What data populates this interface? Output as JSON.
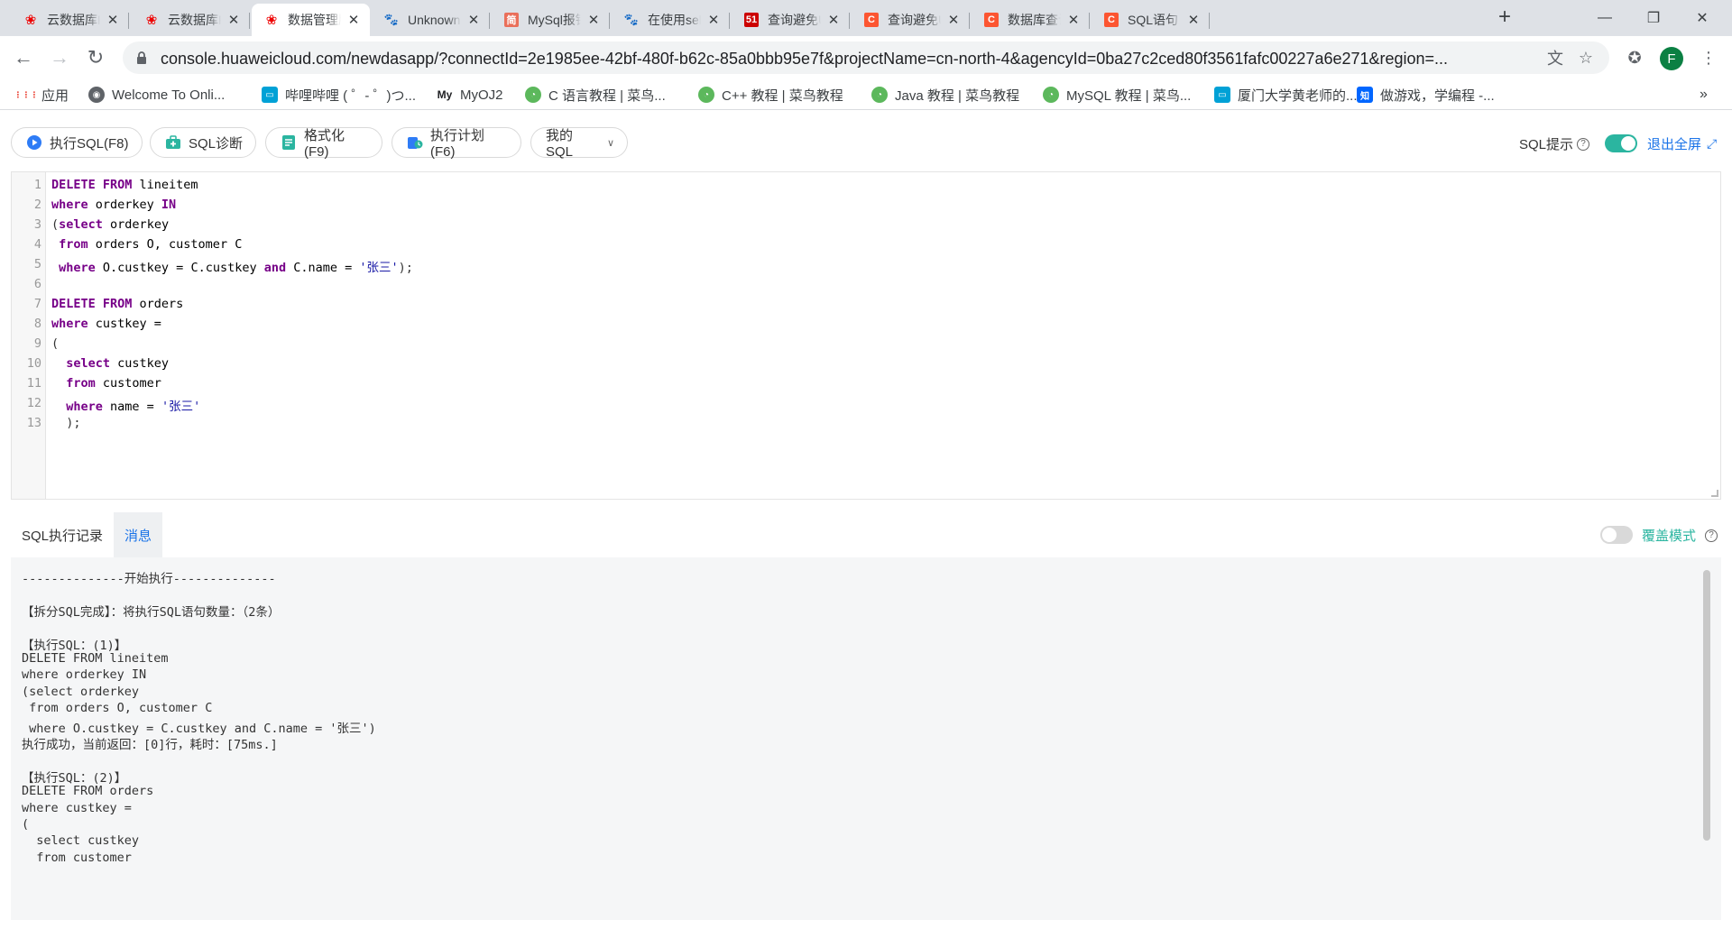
{
  "browser": {
    "tabs": [
      {
        "title": "云数据库RDS",
        "favicon": "huawei-icon"
      },
      {
        "title": "云数据库RDS",
        "favicon": "huawei-icon"
      },
      {
        "title": "数据管理服务",
        "favicon": "huawei-icon",
        "active": true
      },
      {
        "title": "Unknown column",
        "favicon": "baidu-paw-icon"
      },
      {
        "title": "MySql报错",
        "favicon": "jianshu-icon"
      },
      {
        "title": "在使用select",
        "favicon": "baidu-paw-icon"
      },
      {
        "title": "查询避免Un",
        "favicon": "51cto-icon"
      },
      {
        "title": "查询避免Un",
        "favicon": "csdn-icon"
      },
      {
        "title": "数据库查询",
        "favicon": "csdn-icon"
      },
      {
        "title": "SQL语句（三",
        "favicon": "csdn-icon"
      }
    ],
    "url": "console.huaweicloud.com/newdasapp/?connectId=2e1985ee-42bf-480f-b62c-85a0bbb95e7f&projectName=cn-north-4&agencyId=0ba27c2ced80f3561fafc00227a6e271&region=...",
    "profile_initial": "F",
    "bookmarks": [
      {
        "label": "应用",
        "icon": "apps-grid-icon"
      },
      {
        "label": "Welcome To Onli...",
        "icon": "globe-icon"
      },
      {
        "label": "哔哩哔哩 ( ゜- ゜)つ...",
        "icon": "bilibili-icon"
      },
      {
        "label": "MyOJ2",
        "icon": "myoj-icon"
      },
      {
        "label": "C 语言教程 | 菜鸟...",
        "icon": "runoob-icon"
      },
      {
        "label": "C++ 教程 | 菜鸟教程",
        "icon": "runoob-icon"
      },
      {
        "label": "Java 教程 | 菜鸟教程",
        "icon": "runoob-icon"
      },
      {
        "label": "MySQL 教程 | 菜鸟...",
        "icon": "runoob-icon"
      },
      {
        "label": "厦门大学黄老师的...",
        "icon": "bilibili-icon"
      },
      {
        "label": "做游戏，学编程 -...",
        "icon": "zhihu-icon"
      }
    ],
    "bookmarks_overflow": "»"
  },
  "toolbar": {
    "execute_label": "执行SQL(F8)",
    "diagnose_label": "SQL诊断",
    "format_label": "格式化(F9)",
    "plan_label": "执行计划(F6)",
    "mysql_label": "我的SQL",
    "sql_hint_label": "SQL提示",
    "sql_hint_enabled": true,
    "exit_fullscreen_label": "退出全屏"
  },
  "editor": {
    "line_numbers": [
      "1",
      "2",
      "3",
      "4",
      "5",
      "6",
      "7",
      "8",
      "9",
      "10",
      "11",
      "12",
      "13"
    ],
    "lines": [
      [
        {
          "t": "DELETE FROM",
          "c": "kw"
        },
        {
          "t": " lineitem",
          "c": "ident"
        }
      ],
      [
        {
          "t": "where",
          "c": "kw"
        },
        {
          "t": " orderkey ",
          "c": "ident"
        },
        {
          "t": "IN",
          "c": "kw"
        }
      ],
      [
        {
          "t": "(",
          "c": "op"
        },
        {
          "t": "select",
          "c": "kw"
        },
        {
          "t": " orderkey",
          "c": "ident"
        }
      ],
      [
        {
          "t": " from",
          "c": "kw"
        },
        {
          "t": " orders O, customer C",
          "c": "ident"
        }
      ],
      [
        {
          "t": " where",
          "c": "kw"
        },
        {
          "t": " O.custkey = C.custkey ",
          "c": "ident"
        },
        {
          "t": "and",
          "c": "kw"
        },
        {
          "t": " C.name = ",
          "c": "ident"
        },
        {
          "t": "'张三'",
          "c": "str"
        },
        {
          "t": ");",
          "c": "op"
        }
      ],
      [],
      [
        {
          "t": "DELETE FROM",
          "c": "kw"
        },
        {
          "t": " orders",
          "c": "ident"
        }
      ],
      [
        {
          "t": "where",
          "c": "kw"
        },
        {
          "t": " custkey =",
          "c": "ident"
        }
      ],
      [
        {
          "t": "(",
          "c": "op"
        }
      ],
      [
        {
          "t": "  select",
          "c": "kw"
        },
        {
          "t": " custkey",
          "c": "ident"
        }
      ],
      [
        {
          "t": "  from",
          "c": "kw"
        },
        {
          "t": " customer",
          "c": "ident"
        }
      ],
      [
        {
          "t": "  where",
          "c": "kw"
        },
        {
          "t": " name = ",
          "c": "ident"
        },
        {
          "t": "'张三'",
          "c": "str"
        }
      ],
      [
        {
          "t": "  );",
          "c": "op"
        }
      ]
    ]
  },
  "lower": {
    "tabs": [
      "SQL执行记录",
      "消息"
    ],
    "active_tab": "消息",
    "cover_mode_label": "覆盖模式",
    "cover_mode_enabled": false,
    "messages": [
      "--------------开始执行--------------",
      "",
      "【拆分SQL完成】：将执行SQL语句数量：（2条）",
      "",
      "【执行SQL：(1)】",
      "DELETE FROM lineitem",
      "where orderkey IN",
      "(select orderkey",
      " from orders O, customer C",
      " where O.custkey = C.custkey and C.name = '张三')",
      "执行成功，当前返回：[0]行，耗时：[75ms.]",
      "",
      "【执行SQL：(2)】",
      "DELETE FROM orders",
      "where custkey =",
      "(",
      "  select custkey",
      "  from customer"
    ]
  }
}
